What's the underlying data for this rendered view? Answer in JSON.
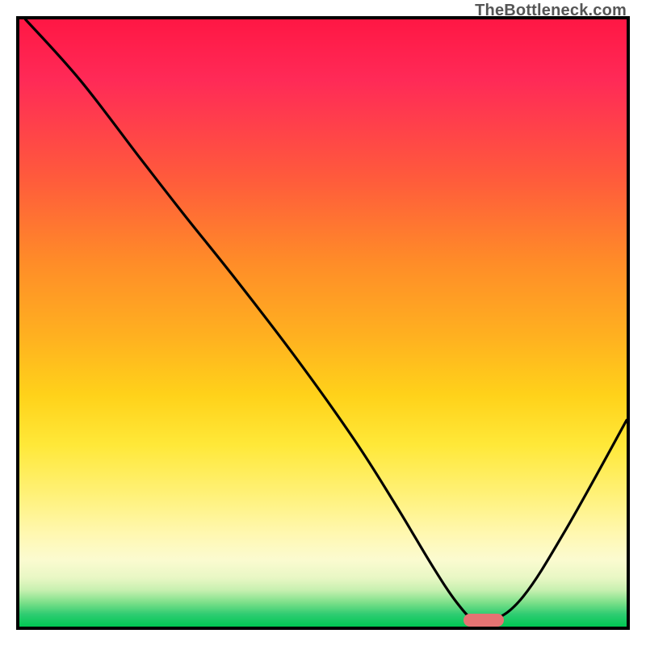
{
  "watermark": "TheBottleneck.com",
  "chart_data": {
    "type": "line",
    "title": "",
    "xlabel": "",
    "ylabel": "",
    "xlim": [
      0,
      100
    ],
    "ylim": [
      0,
      100
    ],
    "grid": false,
    "legend": false,
    "series": [
      {
        "name": "curve",
        "x": [
          1,
          10,
          20,
          27,
          35,
          45,
          55,
          62,
          68,
          72,
          75,
          78,
          83,
          90,
          100
        ],
        "y": [
          100,
          90,
          77,
          68,
          58,
          45,
          31,
          20,
          10,
          4,
          1,
          1,
          5,
          16,
          34
        ]
      }
    ],
    "marker": {
      "x": 76.5,
      "y": 1
    },
    "gradient_stops": [
      {
        "pos": 0,
        "color": "#ff1744"
      },
      {
        "pos": 50,
        "color": "#ffb020"
      },
      {
        "pos": 80,
        "color": "#fff176"
      },
      {
        "pos": 100,
        "color": "#00c853"
      }
    ]
  }
}
